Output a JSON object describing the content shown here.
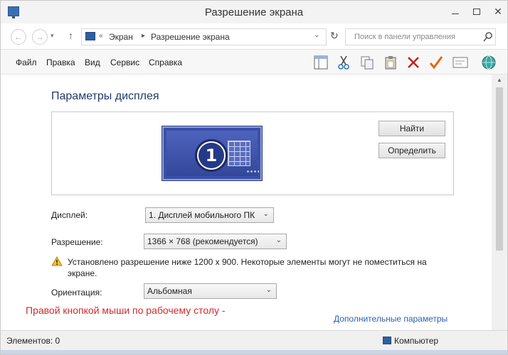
{
  "window": {
    "title": "Разрешение экрана"
  },
  "address": {
    "crumb1": "Экран",
    "crumb2": "Разрешение экрана",
    "search_placeholder": "Поиск в панели управления"
  },
  "menu": {
    "items": [
      "Файл",
      "Правка",
      "Вид",
      "Сервис",
      "Справка"
    ]
  },
  "toolbar_icons": [
    "layout-icon",
    "cut-icon",
    "copy-icon",
    "paste-icon",
    "delete-icon",
    "check-icon",
    "properties-icon",
    "globe-icon"
  ],
  "main": {
    "section_title": "Параметры дисплея",
    "monitor_number": "1",
    "find_button": "Найти",
    "identify_button": "Определить",
    "display_label": "Дисплей:",
    "display_value": "1. Дисплей мобильного ПК",
    "resolution_label": "Разрешение:",
    "resolution_value": "1366 × 768 (рекомендуется)",
    "warning_text": "Установлено разрешение ниже 1200 x 900. Некоторые элементы могут не поместиться на экране.",
    "orientation_label": "Ориентация:",
    "orientation_value": "Альбомная",
    "annotation": "Правой кнопкой мыши по рабочему столу -",
    "more_link": "Дополнительные параметры"
  },
  "status": {
    "items": "Элементов: 0",
    "location": "Компьютер"
  },
  "colors": {
    "accent_blue": "#3b4fa8",
    "annotation_red": "#d42a2a",
    "link_blue": "#2b62b3"
  }
}
